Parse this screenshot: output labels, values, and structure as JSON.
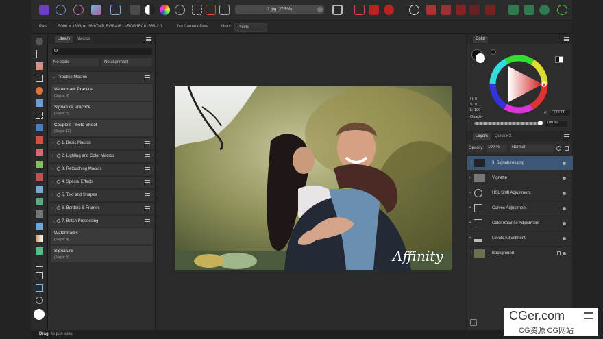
{
  "toolbar": {
    "document_title": "1.jpg (27.5%)"
  },
  "context_bar": {
    "tool_name": "Pan",
    "document_info": "5000 × 3333px, 16.67MP, RGBA/8 - sRGB IEC61966-2.1",
    "camera_data": "No Camera Data",
    "units_label": "Units:",
    "units_value": "Pixels"
  },
  "library_panel": {
    "tabs": [
      "Library",
      "Macros"
    ],
    "search_placeholder": "",
    "scale_option": "No scale",
    "alignment_option": "No alignment",
    "categories": [
      {
        "label": "Practice Macros",
        "expanded": true
      },
      {
        "label": "1. Basic Macros"
      },
      {
        "label": "2. Lighting and Color Macros"
      },
      {
        "label": "3. Retouching Macros"
      },
      {
        "label": "4. Special Effects"
      },
      {
        "label": "5. Text and Shapes"
      },
      {
        "label": "6. Borders & Frames"
      },
      {
        "label": "7. Batch Processing",
        "expanded": true
      }
    ],
    "practice_macros": [
      {
        "title": "Watermark Practice",
        "steps": "(Steps: 4)"
      },
      {
        "title": "Signature Practice",
        "steps": "(Steps: 5)"
      },
      {
        "title": "Couple's Photo Shoot",
        "steps": "(Steps: 11)"
      }
    ],
    "batch_macros": [
      {
        "title": "Watermarks",
        "steps": "(Steps: 4)"
      },
      {
        "title": "Signature",
        "steps": "(Steps: 5)"
      }
    ]
  },
  "canvas": {
    "signature_text": "Affinity"
  },
  "color_panel": {
    "tab": "Color",
    "h": "H: 0",
    "s": "S: 0",
    "l": "L: 100",
    "hex_label": "#:",
    "hex_value": "FFFFFF",
    "opacity_label": "Opacity",
    "opacity_value": "100 %"
  },
  "layers_panel": {
    "tabs": [
      "Layers",
      "Quick FX"
    ],
    "opacity_label": "Opacity:",
    "opacity_value": "100 %",
    "blend_mode": "Normal",
    "layers": [
      {
        "name": "3. Signatures.png",
        "selected": true
      },
      {
        "name": "Vignette"
      },
      {
        "name": "HSL Shift Adjustment"
      },
      {
        "name": "Curves Adjustment"
      },
      {
        "name": "Color Balance Adjustment"
      },
      {
        "name": "Levels Adjustment"
      },
      {
        "name": "Background",
        "locked": true
      }
    ]
  },
  "status_bar": {
    "action": "Drag",
    "hint": "to pan view."
  },
  "watermark": {
    "site": "CGer.com",
    "subtitle": "CG资源 CG网站"
  },
  "colors": {
    "accent": "#3d5a80",
    "selected_layer": "#3b5777"
  }
}
